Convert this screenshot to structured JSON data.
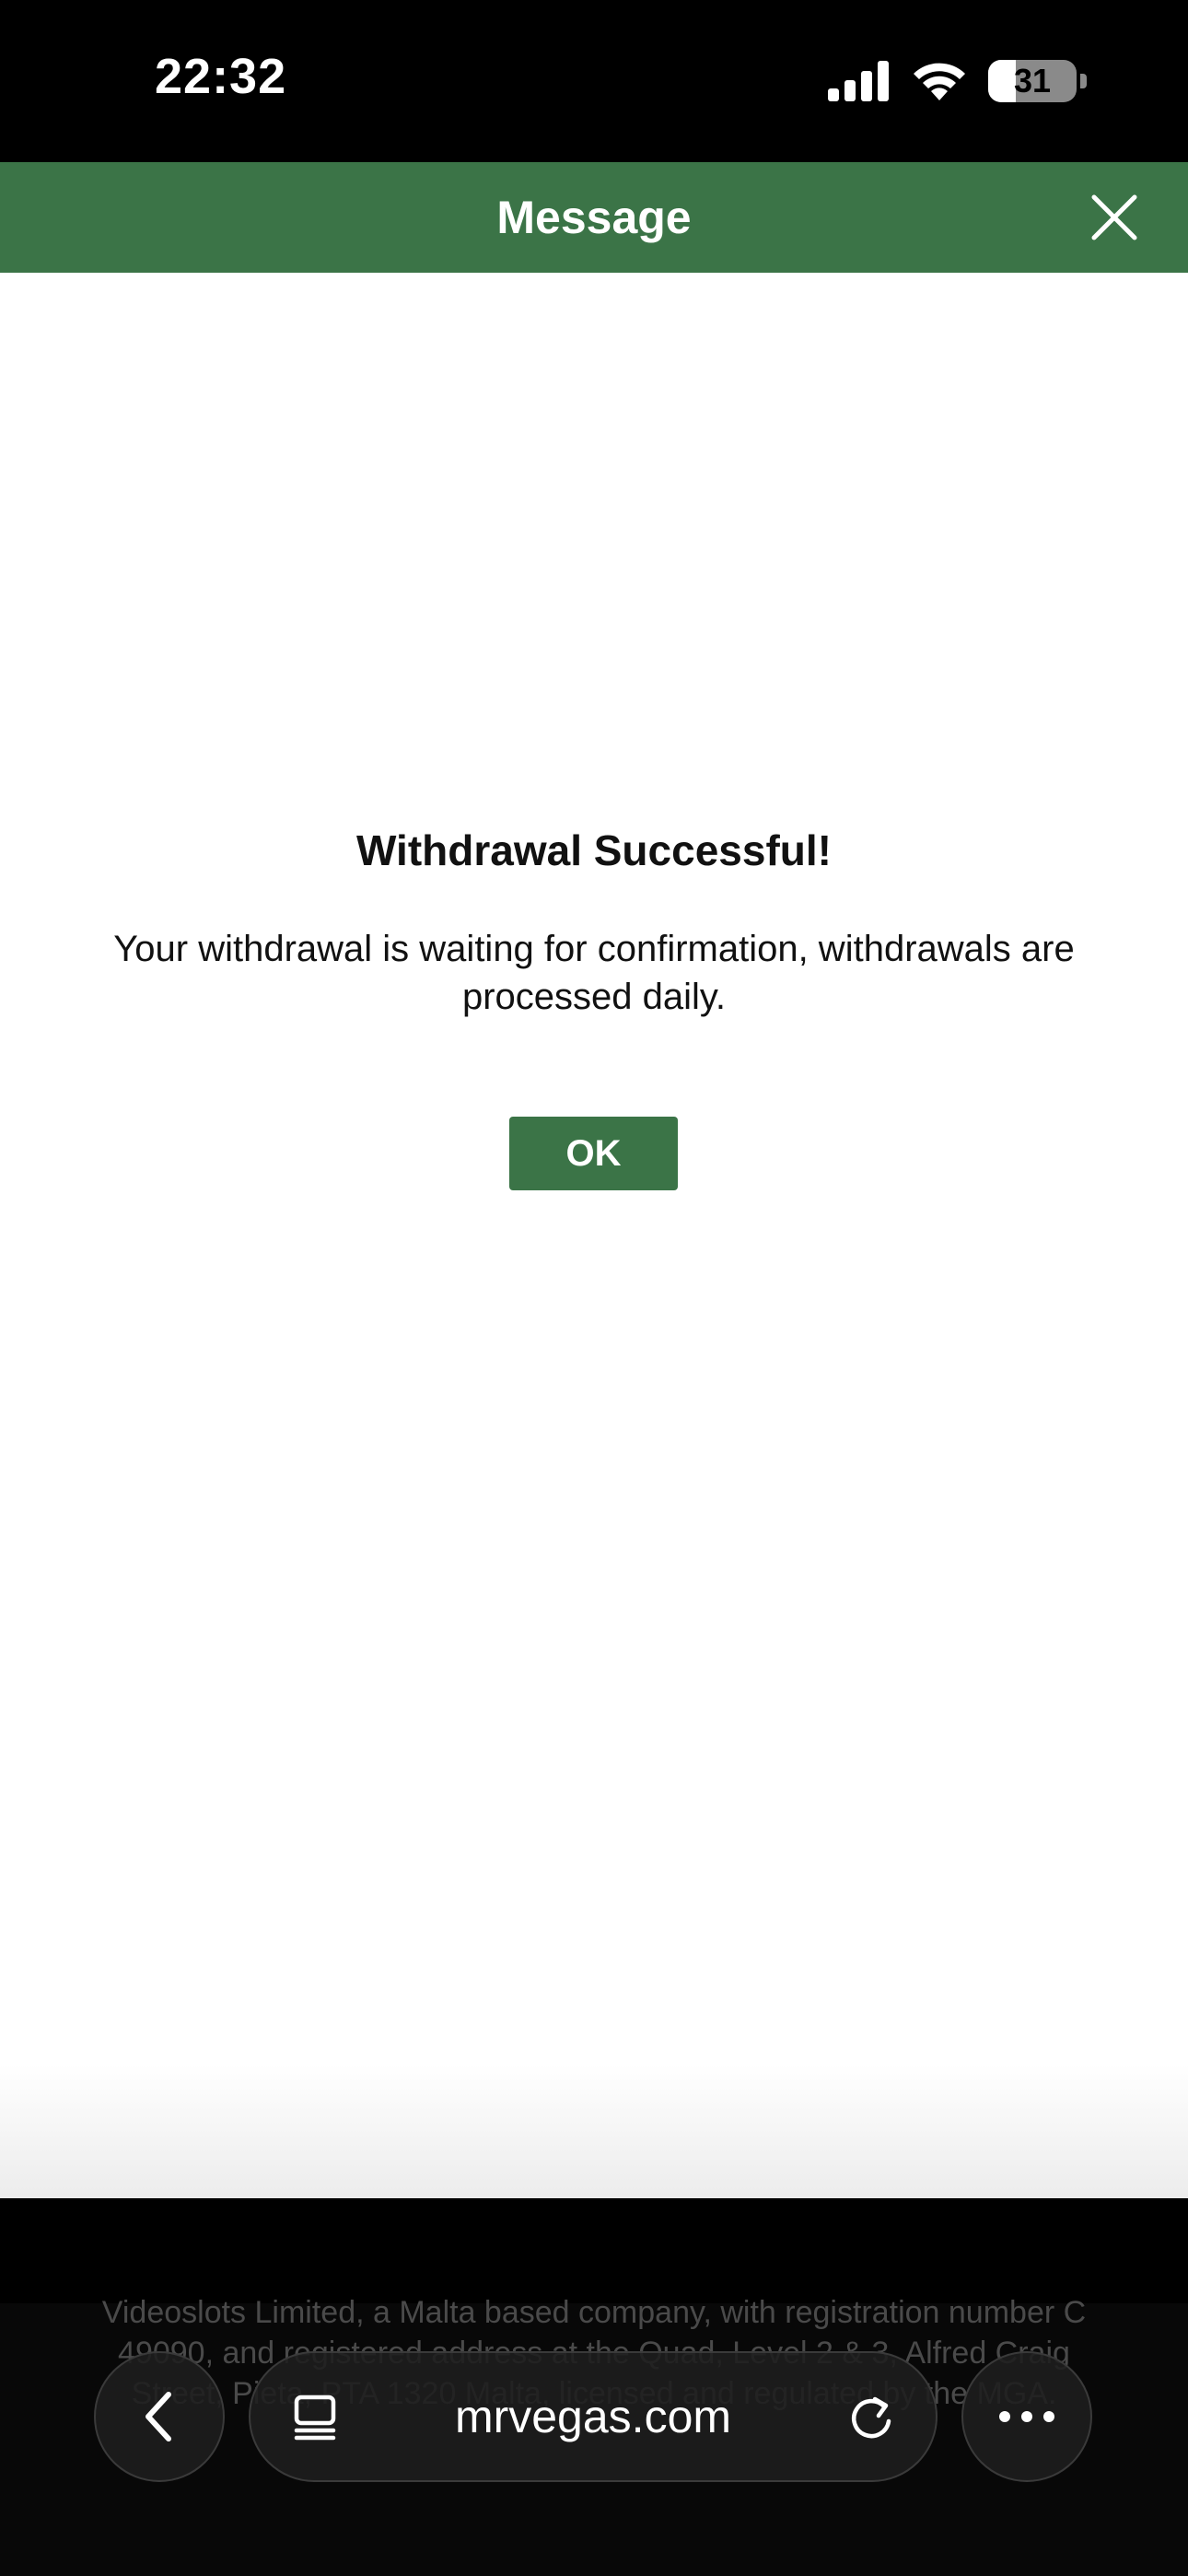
{
  "status_bar": {
    "time": "22:32",
    "battery_text": "31",
    "battery_level_percent": 31,
    "icons": [
      "signal-icon",
      "wifi-icon",
      "battery-icon"
    ]
  },
  "header": {
    "title": "Message",
    "close_icon": "close-icon",
    "background_color": "#3b7447"
  },
  "dialog": {
    "title": "Withdrawal Successful!",
    "message": "Your withdrawal is waiting for confirmation, withdrawals are processed daily.",
    "ok_label": "OK",
    "button_color": "#3b7447"
  },
  "footer": {
    "text": "Videoslots Limited, a Malta based company, with registration number C 49090, and registered address at the Quad, Level 2 & 3, Alfred Craig Street, Pieta, PTA 1320 Malta, licensed and regulated by the MGA."
  },
  "browser": {
    "url": "mrvegas.com",
    "icons": [
      "back-chevron-icon",
      "tab-overview-icon",
      "reload-icon",
      "more-dots-icon"
    ]
  }
}
